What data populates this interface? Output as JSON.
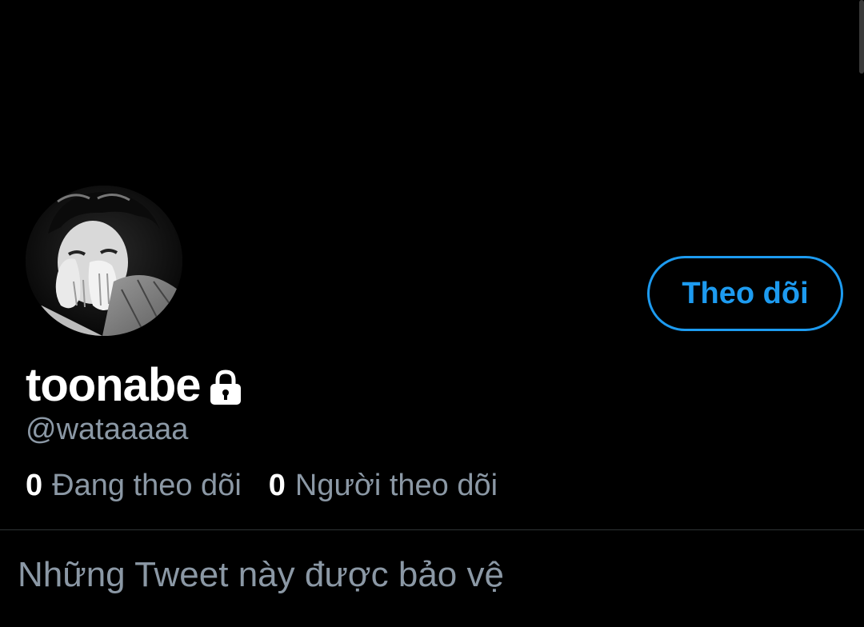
{
  "profile": {
    "display_name": "toonabe",
    "handle": "@wataaaaa",
    "locked_icon": "lock-icon",
    "avatar_icon": "avatar"
  },
  "actions": {
    "follow_label": "Theo dõi"
  },
  "stats": {
    "following_count": "0",
    "following_label": "Đang theo dõi",
    "followers_count": "0",
    "followers_label": "Người theo dõi"
  },
  "notice": {
    "protected_text": "Những Tweet này được bảo vệ"
  },
  "colors": {
    "background": "#000000",
    "accent": "#1d9bf0",
    "primary_text": "#ffffff",
    "secondary_text": "#8b98a5",
    "divider": "#2f3336"
  }
}
